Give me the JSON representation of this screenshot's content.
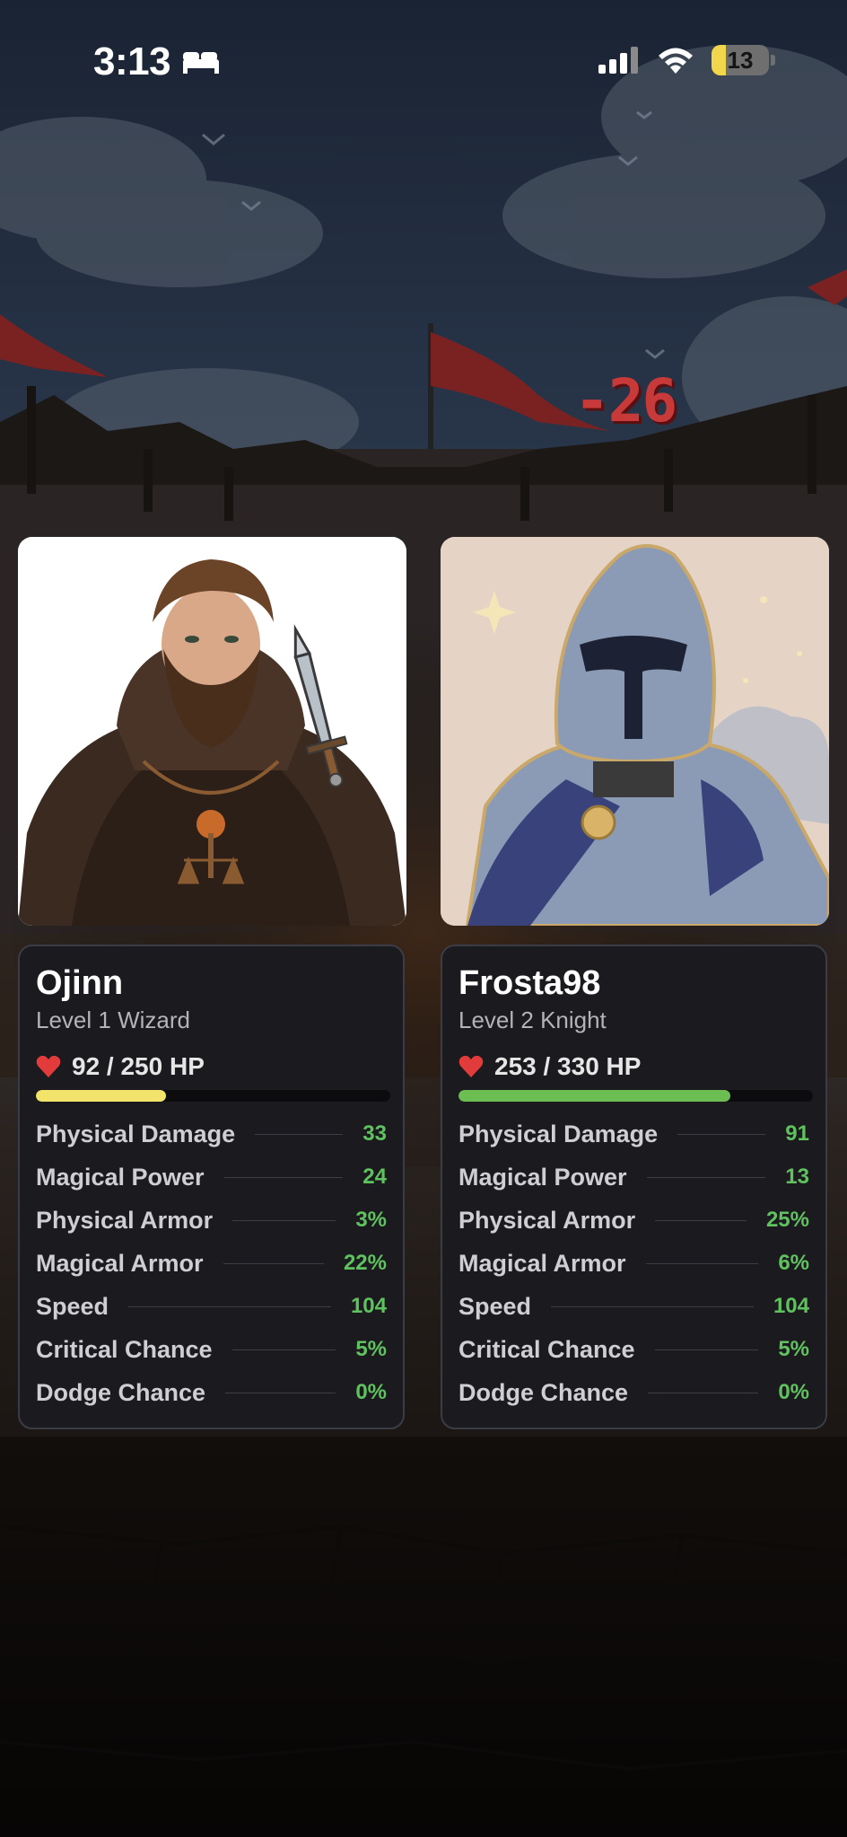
{
  "status_bar": {
    "time": "3:13",
    "battery": "13",
    "battery_level": 0.13,
    "icons": [
      "bed-icon",
      "cellular-signal-icon",
      "wifi-icon",
      "battery-icon"
    ]
  },
  "battle": {
    "damage_popup": "-26"
  },
  "players": [
    {
      "name": "Ojinn",
      "subtitle": "Level 1 Wizard",
      "hp_text": "92 / 250 HP",
      "hp_current": 92,
      "hp_max": 250,
      "hp_color": "#f2e36b",
      "stats": [
        {
          "label": "Physical Damage",
          "value": "33"
        },
        {
          "label": "Magical Power",
          "value": "24"
        },
        {
          "label": "Physical Armor",
          "value": "3%"
        },
        {
          "label": "Magical Armor",
          "value": "22%"
        },
        {
          "label": "Speed",
          "value": "104"
        },
        {
          "label": "Critical Chance",
          "value": "5%"
        },
        {
          "label": "Dodge Chance",
          "value": "0%"
        }
      ]
    },
    {
      "name": "Frosta98",
      "subtitle": "Level 2 Knight",
      "hp_text": "253 / 330 HP",
      "hp_current": 253,
      "hp_max": 330,
      "hp_color": "#6cbd52",
      "stats": [
        {
          "label": "Physical Damage",
          "value": "91"
        },
        {
          "label": "Magical Power",
          "value": "13"
        },
        {
          "label": "Physical Armor",
          "value": "25%"
        },
        {
          "label": "Magical Armor",
          "value": "6%"
        },
        {
          "label": "Speed",
          "value": "104"
        },
        {
          "label": "Critical Chance",
          "value": "5%"
        },
        {
          "label": "Dodge Chance",
          "value": "0%"
        }
      ]
    }
  ],
  "colors": {
    "stat_value": "#5fc25f",
    "damage": "#c83a3a",
    "heart": "#e23b3b",
    "card_bg": "#1b1a1e"
  }
}
